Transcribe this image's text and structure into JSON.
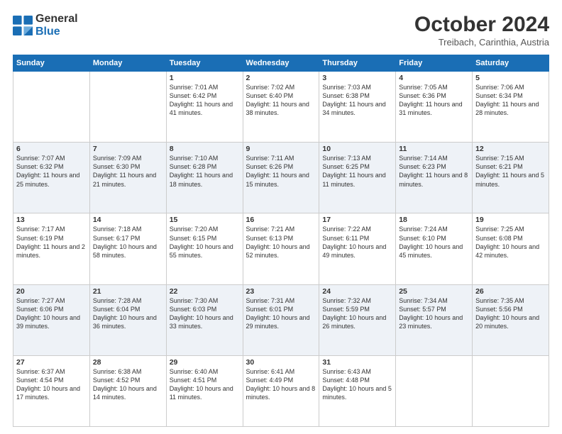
{
  "logo": {
    "line1": "General",
    "line2": "Blue"
  },
  "title": "October 2024",
  "location": "Treibach, Carinthia, Austria",
  "weekdays": [
    "Sunday",
    "Monday",
    "Tuesday",
    "Wednesday",
    "Thursday",
    "Friday",
    "Saturday"
  ],
  "weeks": [
    [
      {
        "day": "",
        "info": ""
      },
      {
        "day": "",
        "info": ""
      },
      {
        "day": "1",
        "info": "Sunrise: 7:01 AM\nSunset: 6:42 PM\nDaylight: 11 hours and 41 minutes."
      },
      {
        "day": "2",
        "info": "Sunrise: 7:02 AM\nSunset: 6:40 PM\nDaylight: 11 hours and 38 minutes."
      },
      {
        "day": "3",
        "info": "Sunrise: 7:03 AM\nSunset: 6:38 PM\nDaylight: 11 hours and 34 minutes."
      },
      {
        "day": "4",
        "info": "Sunrise: 7:05 AM\nSunset: 6:36 PM\nDaylight: 11 hours and 31 minutes."
      },
      {
        "day": "5",
        "info": "Sunrise: 7:06 AM\nSunset: 6:34 PM\nDaylight: 11 hours and 28 minutes."
      }
    ],
    [
      {
        "day": "6",
        "info": "Sunrise: 7:07 AM\nSunset: 6:32 PM\nDaylight: 11 hours and 25 minutes."
      },
      {
        "day": "7",
        "info": "Sunrise: 7:09 AM\nSunset: 6:30 PM\nDaylight: 11 hours and 21 minutes."
      },
      {
        "day": "8",
        "info": "Sunrise: 7:10 AM\nSunset: 6:28 PM\nDaylight: 11 hours and 18 minutes."
      },
      {
        "day": "9",
        "info": "Sunrise: 7:11 AM\nSunset: 6:26 PM\nDaylight: 11 hours and 15 minutes."
      },
      {
        "day": "10",
        "info": "Sunrise: 7:13 AM\nSunset: 6:25 PM\nDaylight: 11 hours and 11 minutes."
      },
      {
        "day": "11",
        "info": "Sunrise: 7:14 AM\nSunset: 6:23 PM\nDaylight: 11 hours and 8 minutes."
      },
      {
        "day": "12",
        "info": "Sunrise: 7:15 AM\nSunset: 6:21 PM\nDaylight: 11 hours and 5 minutes."
      }
    ],
    [
      {
        "day": "13",
        "info": "Sunrise: 7:17 AM\nSunset: 6:19 PM\nDaylight: 11 hours and 2 minutes."
      },
      {
        "day": "14",
        "info": "Sunrise: 7:18 AM\nSunset: 6:17 PM\nDaylight: 10 hours and 58 minutes."
      },
      {
        "day": "15",
        "info": "Sunrise: 7:20 AM\nSunset: 6:15 PM\nDaylight: 10 hours and 55 minutes."
      },
      {
        "day": "16",
        "info": "Sunrise: 7:21 AM\nSunset: 6:13 PM\nDaylight: 10 hours and 52 minutes."
      },
      {
        "day": "17",
        "info": "Sunrise: 7:22 AM\nSunset: 6:11 PM\nDaylight: 10 hours and 49 minutes."
      },
      {
        "day": "18",
        "info": "Sunrise: 7:24 AM\nSunset: 6:10 PM\nDaylight: 10 hours and 45 minutes."
      },
      {
        "day": "19",
        "info": "Sunrise: 7:25 AM\nSunset: 6:08 PM\nDaylight: 10 hours and 42 minutes."
      }
    ],
    [
      {
        "day": "20",
        "info": "Sunrise: 7:27 AM\nSunset: 6:06 PM\nDaylight: 10 hours and 39 minutes."
      },
      {
        "day": "21",
        "info": "Sunrise: 7:28 AM\nSunset: 6:04 PM\nDaylight: 10 hours and 36 minutes."
      },
      {
        "day": "22",
        "info": "Sunrise: 7:30 AM\nSunset: 6:03 PM\nDaylight: 10 hours and 33 minutes."
      },
      {
        "day": "23",
        "info": "Sunrise: 7:31 AM\nSunset: 6:01 PM\nDaylight: 10 hours and 29 minutes."
      },
      {
        "day": "24",
        "info": "Sunrise: 7:32 AM\nSunset: 5:59 PM\nDaylight: 10 hours and 26 minutes."
      },
      {
        "day": "25",
        "info": "Sunrise: 7:34 AM\nSunset: 5:57 PM\nDaylight: 10 hours and 23 minutes."
      },
      {
        "day": "26",
        "info": "Sunrise: 7:35 AM\nSunset: 5:56 PM\nDaylight: 10 hours and 20 minutes."
      }
    ],
    [
      {
        "day": "27",
        "info": "Sunrise: 6:37 AM\nSunset: 4:54 PM\nDaylight: 10 hours and 17 minutes."
      },
      {
        "day": "28",
        "info": "Sunrise: 6:38 AM\nSunset: 4:52 PM\nDaylight: 10 hours and 14 minutes."
      },
      {
        "day": "29",
        "info": "Sunrise: 6:40 AM\nSunset: 4:51 PM\nDaylight: 10 hours and 11 minutes."
      },
      {
        "day": "30",
        "info": "Sunrise: 6:41 AM\nSunset: 4:49 PM\nDaylight: 10 hours and 8 minutes."
      },
      {
        "day": "31",
        "info": "Sunrise: 6:43 AM\nSunset: 4:48 PM\nDaylight: 10 hours and 5 minutes."
      },
      {
        "day": "",
        "info": ""
      },
      {
        "day": "",
        "info": ""
      }
    ]
  ]
}
